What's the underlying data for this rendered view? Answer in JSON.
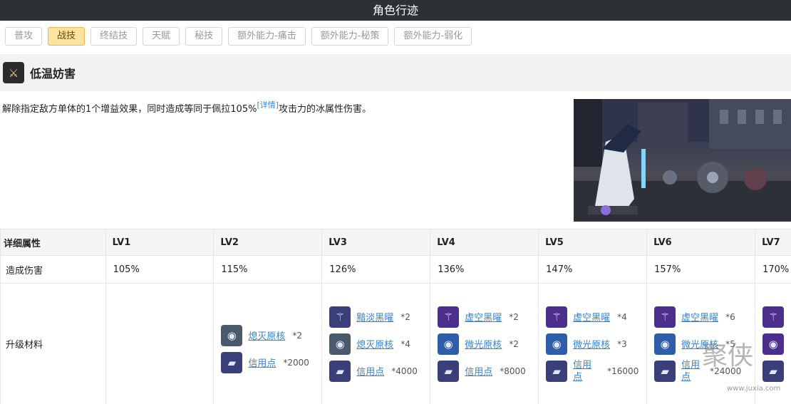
{
  "header": {
    "title": "角色行迹"
  },
  "tabs": [
    {
      "label": "普攻",
      "active": false
    },
    {
      "label": "战技",
      "active": true
    },
    {
      "label": "终结技",
      "active": false
    },
    {
      "label": "天赋",
      "active": false
    },
    {
      "label": "秘技",
      "active": false
    },
    {
      "label": "额外能力-痛击",
      "active": false
    },
    {
      "label": "额外能力-秘策",
      "active": false
    },
    {
      "label": "额外能力-弱化",
      "active": false
    }
  ],
  "skill": {
    "name": "低温妨害",
    "icon": "crossed-blades-icon",
    "desc_before": "解除指定敌方单体的1个增益效果，同时造成等同于佩拉105%",
    "desc_link": "[详情]",
    "desc_after": "攻击力的冰属性伤害。"
  },
  "table": {
    "header_label": "详细属性",
    "levels": [
      "LV1",
      "LV2",
      "LV3",
      "LV4",
      "LV5",
      "LV6",
      "LV7"
    ],
    "damage_label": "造成伤害",
    "damage_values": [
      "105%",
      "115%",
      "126%",
      "136%",
      "147%",
      "157%",
      "170%"
    ],
    "materials_label": "升级材料",
    "materials": {
      "lv2": [
        {
          "name": "熄灭原核",
          "count": "*2",
          "icon": "core-icon"
        },
        {
          "name": "信用点",
          "count": "*2000",
          "icon": "credit-icon"
        }
      ],
      "lv3": [
        {
          "name": "黯淡黑曜",
          "count": "*2",
          "icon": "obsidian-icon"
        },
        {
          "name": "熄灭原核",
          "count": "*4",
          "icon": "core-icon"
        },
        {
          "name": "信用点",
          "count": "*4000",
          "icon": "credit-icon"
        }
      ],
      "lv4": [
        {
          "name": "虚空黑曜",
          "count": "*2",
          "icon": "obsidian-icon"
        },
        {
          "name": "微光原核",
          "count": "*2",
          "icon": "core-icon"
        },
        {
          "name": "信用点",
          "count": "*8000",
          "icon": "credit-icon"
        }
      ],
      "lv5": [
        {
          "name": "虚空黑曜",
          "count": "*4",
          "icon": "obsidian-icon"
        },
        {
          "name": "微光原核",
          "count": "*3",
          "icon": "core-icon"
        },
        {
          "name": "信用点",
          "count": "*16000",
          "icon": "credit-icon"
        }
      ],
      "lv6": [
        {
          "name": "虚空黑曜",
          "count": "*6",
          "icon": "obsidian-icon"
        },
        {
          "name": "微光原核",
          "count": "*5",
          "icon": "core-icon"
        },
        {
          "name": "信用点",
          "count": "*24000",
          "icon": "credit-icon"
        }
      ]
    }
  },
  "watermark": {
    "text": "聚侠",
    "url": "www.juxia.com"
  }
}
